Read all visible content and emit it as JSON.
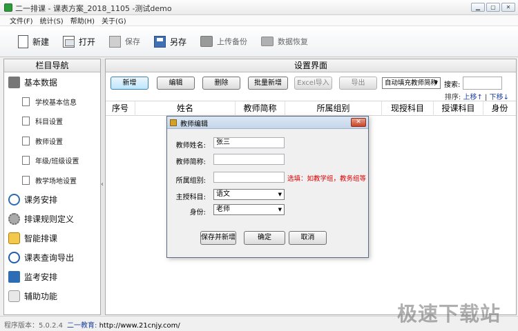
{
  "window": {
    "title": "二一排课 - 课表方案_2018_1105 -测试demo",
    "controls": [
      "▁",
      "▢",
      "✕"
    ]
  },
  "menubar": [
    "文件(F)",
    "统计(S)",
    "帮助(H)",
    "关于(G)"
  ],
  "toolbar": [
    {
      "label": "新建",
      "icon": "new-file-icon",
      "enabled": true
    },
    {
      "label": "打开",
      "icon": "open-file-icon",
      "enabled": true
    },
    {
      "label": "保存",
      "icon": "save-icon",
      "enabled": false
    },
    {
      "label": "另存",
      "icon": "save-as-icon",
      "enabled": true
    },
    {
      "label": "上传备份",
      "icon": "upload-backup-icon",
      "enabled": false
    },
    {
      "label": "数据恢复",
      "icon": "data-restore-icon",
      "enabled": false
    }
  ],
  "sidebar": {
    "title": "栏目导航",
    "groups": [
      {
        "label": "基本数据",
        "icon": "basic-data-icon",
        "items": [
          "学校基本信息",
          "科目设置",
          "教师设置",
          "年级/班级设置",
          "教学场地设置"
        ]
      },
      {
        "label": "课务安排",
        "icon": "task-icon"
      },
      {
        "label": "排课规则定义",
        "icon": "rule-gear-icon"
      },
      {
        "label": "智能排课",
        "icon": "smart-schedule-icon"
      },
      {
        "label": "课表查询导出",
        "icon": "search-export-icon"
      },
      {
        "label": "监考安排",
        "icon": "monitor-icon"
      },
      {
        "label": "辅助功能",
        "icon": "tools-icon"
      }
    ]
  },
  "main": {
    "title": "设置界面",
    "buttons": {
      "add": "新增",
      "edit": "编辑",
      "delete": "删除",
      "batch_add": "批量新增",
      "excel_import": "Excel导入",
      "export": "导出"
    },
    "auto_fill_select": "自动填充教师简称",
    "search_label": "搜索:",
    "sort": {
      "label": "排序:",
      "up": "上移",
      "sep": "|",
      "down": "下移"
    },
    "columns": [
      "序号",
      "姓名",
      "教师简称",
      "所属组别",
      "现授科目",
      "授课科目",
      "身份"
    ]
  },
  "dialog": {
    "title": "教师编辑",
    "fields": {
      "name_label": "教师姓名:",
      "name_value": "张三",
      "short_label": "教师简称:",
      "short_value": "",
      "group_label": "所属组别:",
      "group_value": "",
      "group_hint": "选填：如教学组，教务组等",
      "subject_label": "主授科目:",
      "subject_value": "语文",
      "role_label": "身份:",
      "role_value": "老师"
    },
    "buttons": {
      "save_new": "保存并新增",
      "ok": "确定",
      "cancel": "取消"
    }
  },
  "status": {
    "version": "程序版本：5.0.2.4",
    "site_label": "二一教育:",
    "site_url": "http://www.21cnjy.com/"
  },
  "watermark": "极速下载站"
}
